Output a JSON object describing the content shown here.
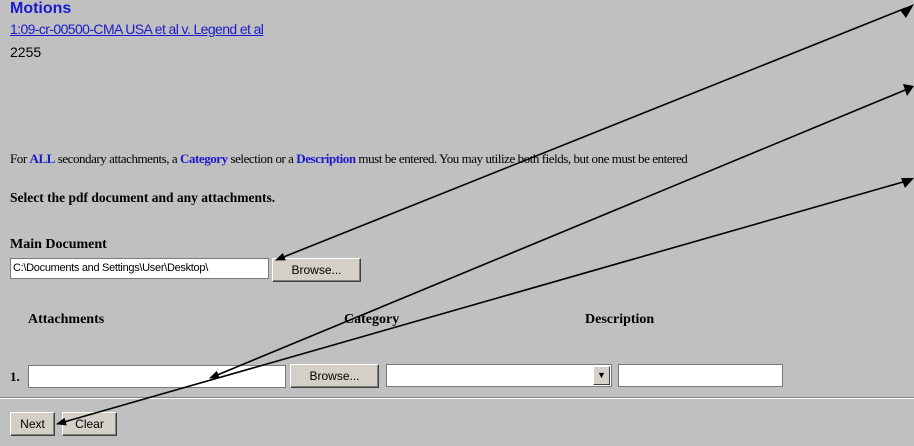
{
  "header": {
    "title": "Motions",
    "case_link": "1:09-cr-00500-CMA USA et al v. Legend et al",
    "doc_number": "2255"
  },
  "notice": {
    "prefix": "For ",
    "all_word": "ALL",
    "part1": " secondary attachments, a ",
    "category_word": "Category",
    "part2": " selection or a ",
    "description_word": "Description",
    "part3": " must be entered. You may utilize both fields, but one must be entered"
  },
  "select_heading": "Select the pdf document and any attachments.",
  "main_document": {
    "heading": "Main Document",
    "file_value": "C:\\Documents and Settings\\User\\Desktop\\",
    "browse_label": "Browse..."
  },
  "attachments": {
    "col_attachments": "Attachments",
    "col_category": "Category",
    "col_description": "Description",
    "rows": [
      {
        "number": "1.",
        "file_value": "",
        "browse_label": "Browse...",
        "category": "",
        "description": ""
      }
    ]
  },
  "buttons": {
    "next_label": "Next",
    "clear_label": "Clear"
  },
  "annotation_arrows": {
    "color": "#000000",
    "count": 3
  }
}
